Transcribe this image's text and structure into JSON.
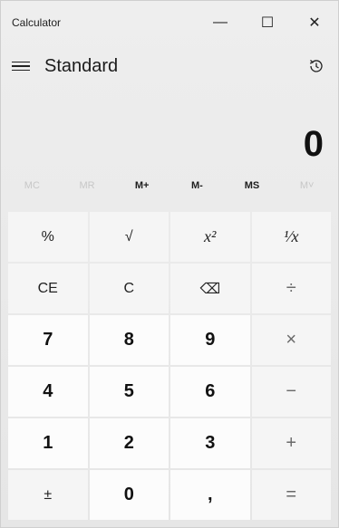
{
  "window": {
    "title": "Calculator"
  },
  "controls": {
    "minimize": "—",
    "maximize": "☐",
    "close": "✕"
  },
  "header": {
    "mode": "Standard"
  },
  "display": {
    "value": "0"
  },
  "memory": [
    {
      "label": "MC",
      "enabled": false
    },
    {
      "label": "MR",
      "enabled": false
    },
    {
      "label": "M+",
      "enabled": true
    },
    {
      "label": "M-",
      "enabled": true
    },
    {
      "label": "MS",
      "enabled": true
    },
    {
      "label": "M˅",
      "enabled": false
    }
  ],
  "keys": {
    "percent": "%",
    "sqrt": "√",
    "square": "x²",
    "reciprocal": "¹⁄x",
    "ce": "CE",
    "c": "C",
    "backspace": "⌫",
    "divide": "÷",
    "seven": "7",
    "eight": "8",
    "nine": "9",
    "multiply": "×",
    "four": "4",
    "five": "5",
    "six": "6",
    "minus": "−",
    "one": "1",
    "two": "2",
    "three": "3",
    "plus": "+",
    "negate": "±",
    "zero": "0",
    "decimal": ",",
    "equals": "="
  }
}
